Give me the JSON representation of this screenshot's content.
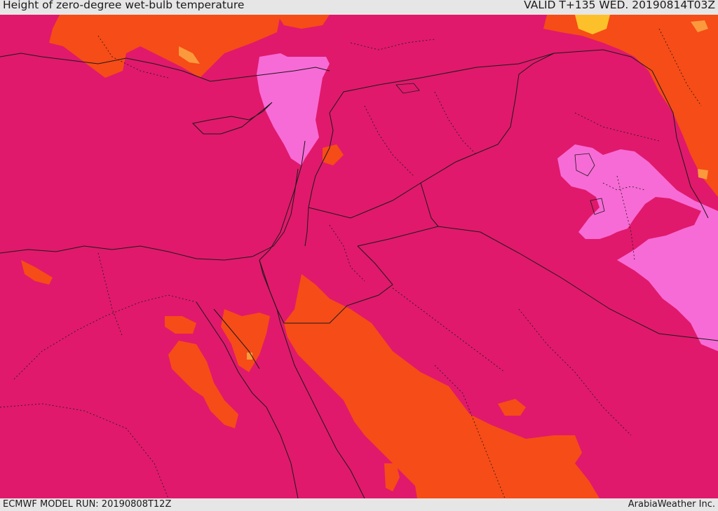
{
  "header": {
    "title": "Height of zero-degree wet-bulb temperature",
    "valid": "VALID T+135 WED. 20190814T03Z"
  },
  "footer": {
    "model_run": "ECMWF MODEL RUN: 20190808T12Z",
    "credit": "ArabiaWeather Inc."
  },
  "colors": {
    "base": "#e0196c",
    "orange": "#f64c17",
    "light_orange": "#fa9a3c",
    "yellow": "#fcc12a",
    "pink": "#f76bd6",
    "border": "#1a1a1a"
  }
}
